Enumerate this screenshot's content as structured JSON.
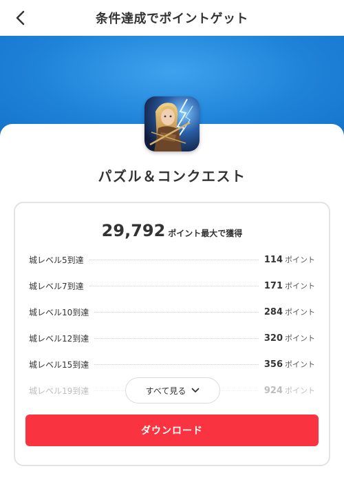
{
  "header": {
    "title": "条件達成でポイントゲット",
    "back_icon": "chevron-left-icon"
  },
  "colors": {
    "banner": "#1f83d8",
    "download_button": "#fa3340"
  },
  "app": {
    "name": "パズル＆コンクエスト",
    "icon": "app-icon-warrior-archer"
  },
  "rewards": {
    "total_points": "29,792",
    "total_suffix": "ポイント最大で獲得",
    "items": [
      {
        "label": "城レベル5到達",
        "points": "114",
        "unit": "ポイント"
      },
      {
        "label": "城レベル7到達",
        "points": "171",
        "unit": "ポイント"
      },
      {
        "label": "城レベル10到達",
        "points": "284",
        "unit": "ポイント"
      },
      {
        "label": "城レベル12到達",
        "points": "320",
        "unit": "ポイント"
      },
      {
        "label": "城レベル15到達",
        "points": "356",
        "unit": "ポイント"
      },
      {
        "label": "城レベル19到達",
        "points": "924",
        "unit": "ポイント"
      }
    ],
    "see_all_label": "すべて見る",
    "see_all_icon": "chevron-down-icon"
  },
  "download_label": "ダウンロード"
}
